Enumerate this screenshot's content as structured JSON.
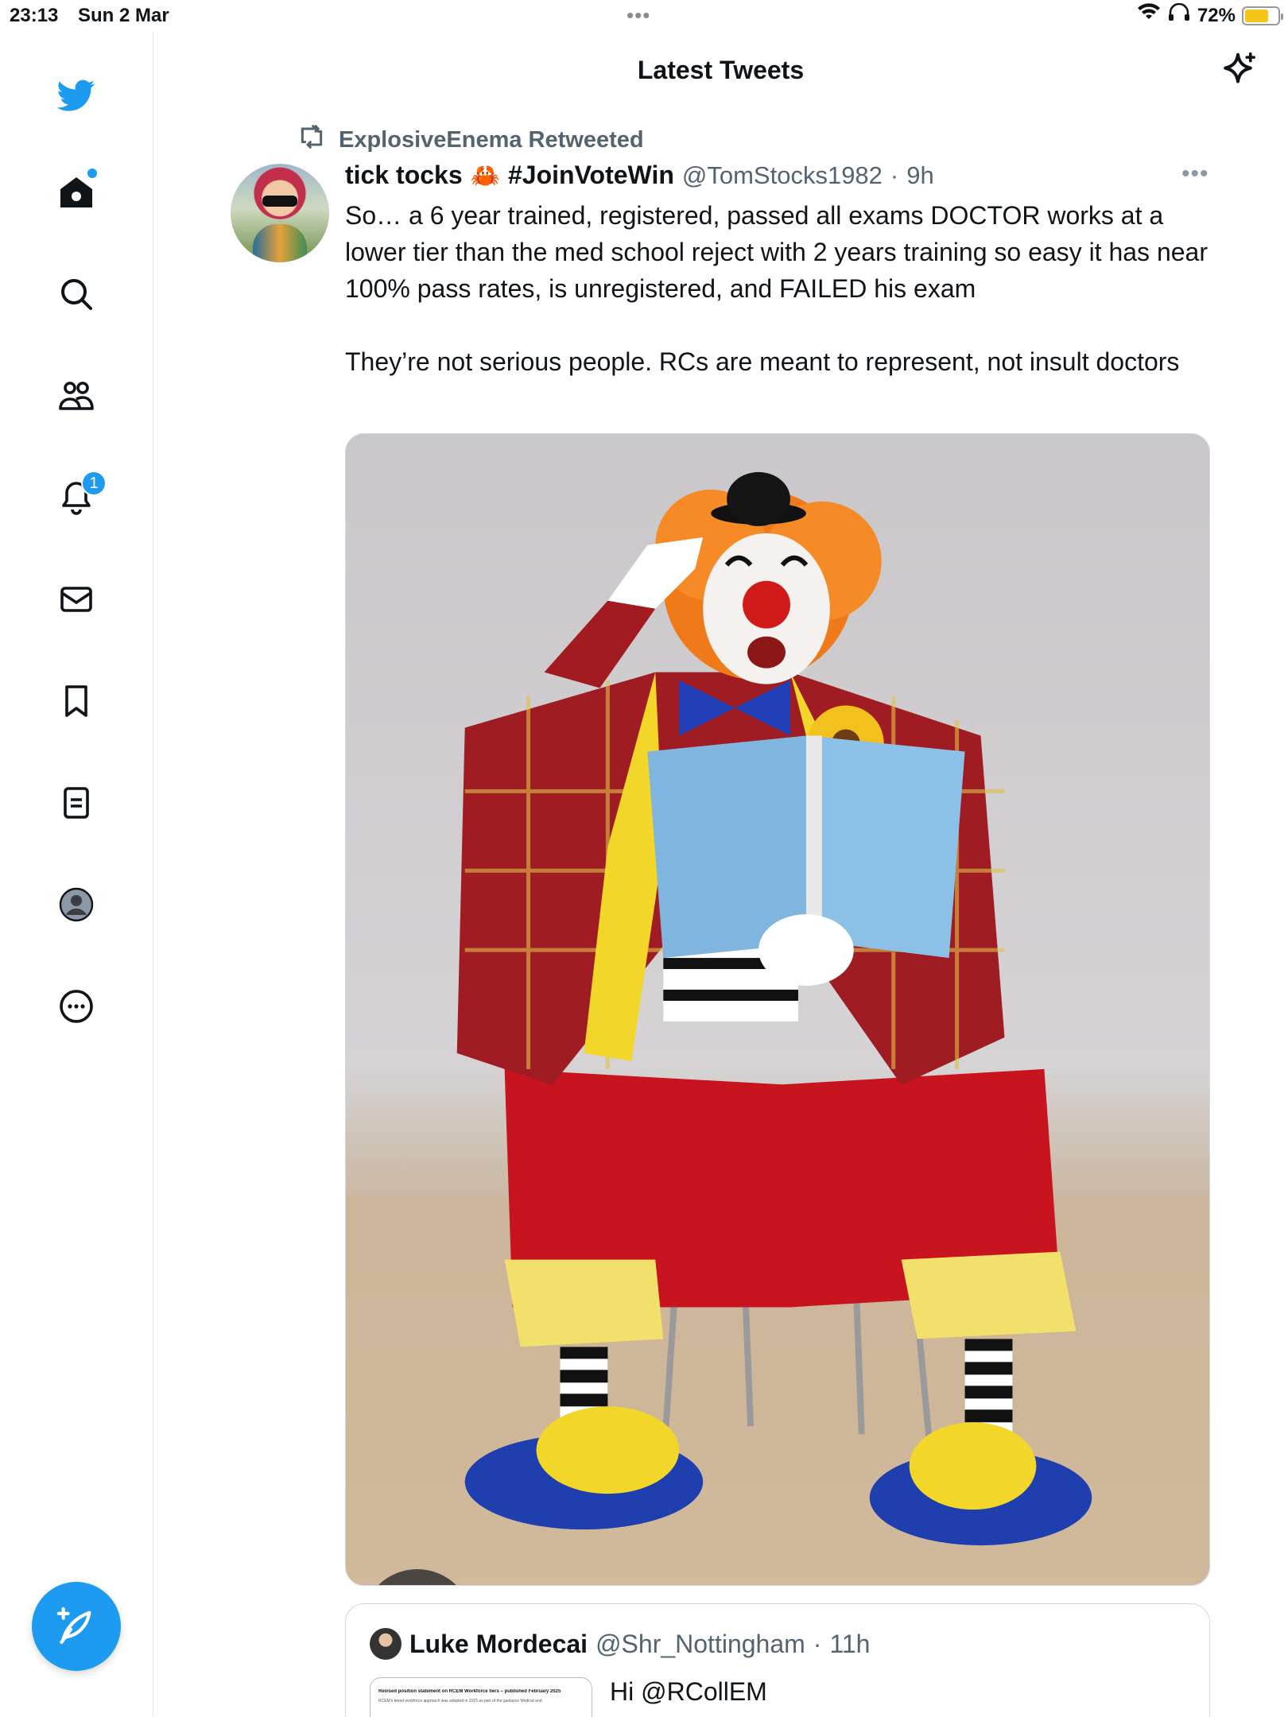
{
  "status_bar": {
    "time": "23:13",
    "date": "Sun 2 Mar",
    "dots": "•••",
    "battery_percent": "72%",
    "battery_level": 0.72
  },
  "header": {
    "title": "Latest Tweets",
    "sparkle_icon": "sparkle-icon"
  },
  "sidebar": {
    "items": [
      {
        "name": "twitter-logo-icon"
      },
      {
        "name": "home-icon"
      },
      {
        "name": "search-icon"
      },
      {
        "name": "communities-icon"
      },
      {
        "name": "notifications-icon",
        "badge": "1"
      },
      {
        "name": "messages-icon"
      },
      {
        "name": "bookmarks-icon"
      },
      {
        "name": "lists-icon"
      },
      {
        "name": "profile-icon"
      },
      {
        "name": "more-icon"
      }
    ],
    "compose_icon": "compose-icon"
  },
  "tweet": {
    "retweeted_by": "ExplosiveEnema Retweeted",
    "name": "tick tocks",
    "emoji": "🦀",
    "hashtag": "#JoinVoteWin",
    "handle": "@TomStocks1982",
    "separator": "·",
    "time": "9h",
    "more": "•••",
    "paragraph1": "So… a 6 year trained, registered, passed all exams DOCTOR works at a lower tier than the med school reject with 2 years training so easy it has near 100% pass rates, is unregistered, and FAILED his exam",
    "paragraph2": "They’re not serious people. RCs are meant to represent, not insult doctors"
  },
  "quote": {
    "name": "Luke Mordecai",
    "handle": "@Shr_Nottingham",
    "separator": "·",
    "time": "11h",
    "text": "Hi @RCollEM",
    "thumb_title": "Revised position statement on RCEM Workforce tiers – published February 2025",
    "thumb_line": "RCEM's tiered workforce approach was adopted in 2015 as part of the guidance Medical and"
  },
  "colors": {
    "accent": "#1d9bf0",
    "secondary_text": "#536471",
    "battery": "#f5c518"
  }
}
